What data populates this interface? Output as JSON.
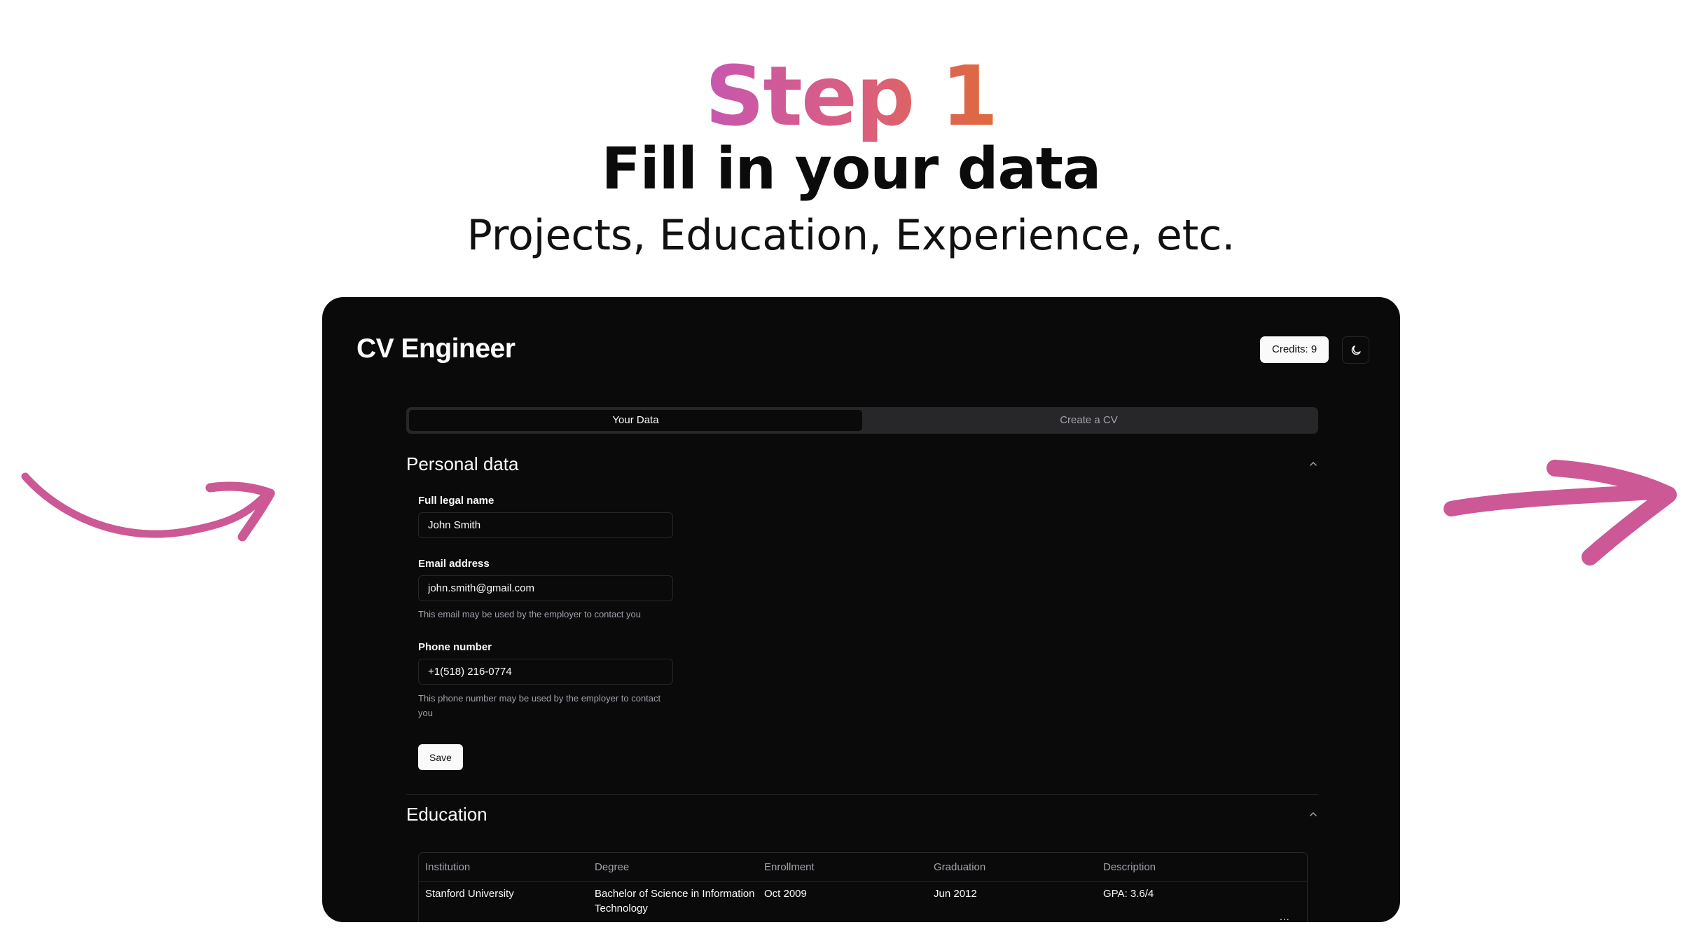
{
  "hero": {
    "step": "Step 1",
    "heading": "Fill in your data",
    "subheading": "Projects, Education, Experience, etc."
  },
  "colors": {
    "step_gradient": [
      "#c757b0",
      "#db5f7c",
      "#de6a3a"
    ],
    "arrow": "#cc5896",
    "app_background": "#0a0a0b"
  },
  "app": {
    "title": "CV Engineer",
    "credits_label": "Credits: 9",
    "theme_toggle_icon": "moon-icon",
    "tabs": [
      {
        "label": "Your Data",
        "active": true
      },
      {
        "label": "Create a CV",
        "active": false
      }
    ],
    "personal": {
      "title": "Personal data",
      "full_name_label": "Full legal name",
      "full_name_value": "John Smith",
      "email_label": "Email address",
      "email_value": "john.smith@gmail.com",
      "email_help": "This email may be used by the employer to contact you",
      "phone_label": "Phone number",
      "phone_value": "+1(518) 216-0774",
      "phone_help": "This phone number may be used by the employer to contact you",
      "save_label": "Save"
    },
    "education": {
      "title": "Education",
      "columns": [
        "Institution",
        "Degree",
        "Enrollment",
        "Graduation",
        "Description"
      ],
      "rows": [
        [
          "Stanford University",
          "Bachelor of Science in Information Technology",
          "Oct 2009",
          "Jun 2012",
          "GPA: 3.6/4"
        ]
      ],
      "row_menu_label": "..."
    }
  }
}
